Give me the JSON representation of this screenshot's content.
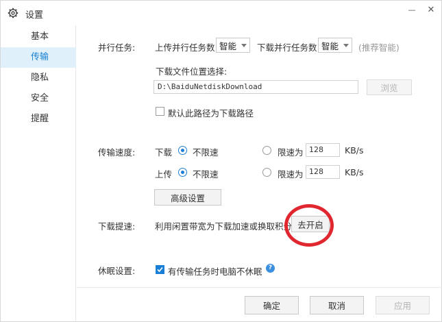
{
  "window": {
    "title": "设置",
    "icon": "gear-icon",
    "minimize_label": "—",
    "close_label": "✕"
  },
  "sidebar": {
    "items": [
      {
        "label": "基本",
        "active": false
      },
      {
        "label": "传输",
        "active": true
      },
      {
        "label": "隐私",
        "active": false
      },
      {
        "label": "安全",
        "active": false
      },
      {
        "label": "提醒",
        "active": false
      }
    ]
  },
  "parallel": {
    "section_label": "并行任务:",
    "upload_label": "上传并行任务数",
    "upload_value": "智能",
    "download_label": "下载并行任务数",
    "download_value": "智能",
    "hint": "(推荐智能)"
  },
  "download_location": {
    "label": "下载文件位置选择:",
    "path": "D:\\BaiduNetdiskDownload",
    "browse_label": "浏览",
    "default_checkbox_label": "默认此路径为下载路径",
    "default_checked": false
  },
  "speed": {
    "section_label": "传输速度:",
    "download": {
      "label": "下载",
      "unlimited_label": "不限速",
      "limit_label": "限速为",
      "limit_value": "128",
      "unit": "KB/s",
      "unlimited_selected": true
    },
    "upload": {
      "label": "上传",
      "unlimited_label": "不限速",
      "limit_label": "限速为",
      "limit_value": "128",
      "unit": "KB/s",
      "unlimited_selected": true
    },
    "advanced_label": "高级设置"
  },
  "accelerate": {
    "section_label": "下载提速:",
    "description": "利用闲置带宽为下载加速或换取积分",
    "button_label": "去开启"
  },
  "sleep": {
    "section_label": "休眠设置:",
    "checkbox_label": "有传输任务时电脑不休眠",
    "checked": true,
    "help_icon": "question-icon",
    "help_symbol": "?"
  },
  "footer": {
    "ok_label": "确定",
    "cancel_label": "取消",
    "apply_label": "应用"
  },
  "colors": {
    "accent": "#1b7fd5",
    "sidebar_active_bg": "#dff0fb",
    "annotation_red": "#e0262f"
  }
}
